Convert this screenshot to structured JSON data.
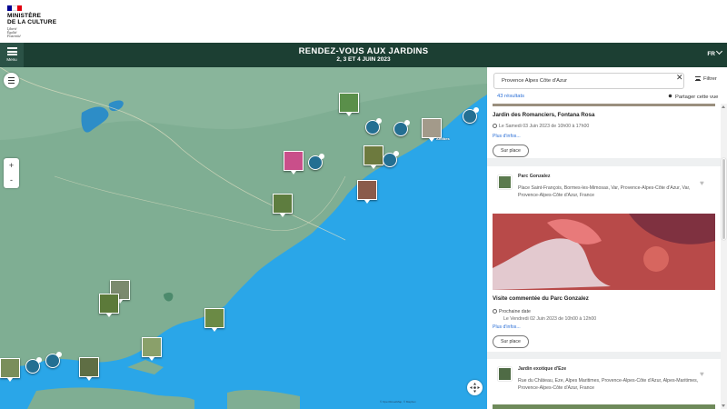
{
  "gov": {
    "logo_lines": [
      "MINISTÈRE",
      "DE LA CULTURE"
    ],
    "motto_lines": [
      "Liberté",
      "Égalité",
      "Fraternité"
    ],
    "flag_colors": [
      "#000091",
      "#ffffff",
      "#e1000f"
    ]
  },
  "banner": {
    "menu_label": "Menu",
    "title": "RENDEZ-VOUS AUX JARDINS",
    "subtitle": "2, 3 ET 4 JUIN 2023",
    "language": "FR",
    "color": "#1c3f33"
  },
  "map": {
    "attribution": "© OpenStreetMap, © Mapbox",
    "city_label": "Antibes",
    "zoom_in": "+",
    "zoom_out": "-",
    "icons": [
      "layers-icon",
      "recenter-icon"
    ],
    "sea_color": "#2aa6e8",
    "land_color": "#7fae93"
  },
  "panel": {
    "search_value": "Provence Alpes Côte d'Azur",
    "clear": "✕",
    "filter_label": "Filtrer",
    "results_count": "43 résultats",
    "share_label": "Partager cette vue",
    "items": [
      {
        "type": "event",
        "title": "Jardin des Romanciers, Fontana Rosa",
        "date": "Le Samedi 03 Juin 2023 de 10h00 à 17h00",
        "more": "Plus d'infos...",
        "onsite": "Sur place"
      },
      {
        "type": "place",
        "name": "Parc Gonzalez",
        "address": "Place Saint-François, Bormes-les-Mimosas, Var, Provence-Alpes-Côte d'Azur, Var, Provence-Alpes-Côte d'Azur, France"
      },
      {
        "type": "event",
        "title": "Visite commentée du Parc Gonzalez",
        "next_label": "Prochaine date",
        "date": "Le Vendredi 02 Juin 2023 de 10h00 à 12h00",
        "more": "Plus d'infos...",
        "onsite": "Sur place"
      },
      {
        "type": "place",
        "name": "Jardin exotique d'Eze",
        "address": "Rue du Château, Eze, Alpes Maritimes, Provence-Alpes-Côte d'Azur, Alpes-Maritimes, Provence-Alpes-Côte d'Azur, France"
      }
    ]
  }
}
